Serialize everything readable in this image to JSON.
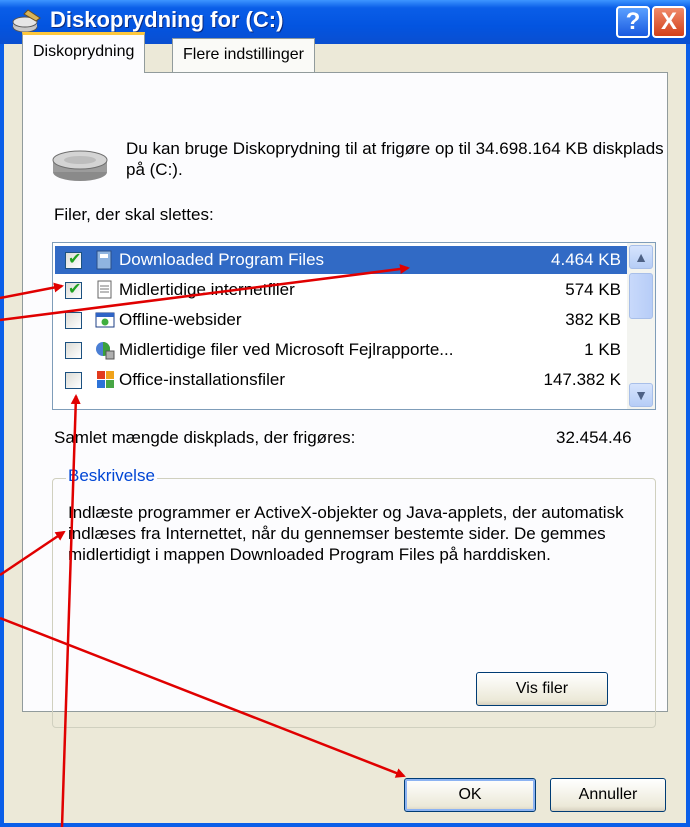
{
  "window": {
    "title": "Diskoprydning for  (C:)",
    "help_button": "?",
    "close_button": "X"
  },
  "tabs": [
    {
      "label": "Diskoprydning",
      "active": true
    },
    {
      "label": "Flere indstillinger",
      "active": false
    }
  ],
  "info": {
    "text": "Du kan bruge Diskoprydning til at frigøre op til 34.698.164 KB diskplads på  (C:).",
    "icon": "hard-drive-icon"
  },
  "files": {
    "label": "Filer, der skal slettes:",
    "items": [
      {
        "name": "Downloaded Program Files",
        "size": "4.464 KB",
        "checked": true,
        "selected": true,
        "icon": "program-files-icon"
      },
      {
        "name": "Midlertidige internetfiler",
        "size": "574 KB",
        "checked": true,
        "selected": false,
        "icon": "document-icon"
      },
      {
        "name": "Offline-websider",
        "size": "382 KB",
        "checked": false,
        "selected": false,
        "icon": "offline-web-icon"
      },
      {
        "name": "Midlertidige filer ved Microsoft Fejlrapporte...",
        "size": "1 KB",
        "checked": false,
        "selected": false,
        "icon": "error-report-icon"
      },
      {
        "name": "Office-installationsfiler",
        "size": "147.382 K",
        "checked": false,
        "selected": false,
        "icon": "office-icon"
      }
    ]
  },
  "total": {
    "label": "Samlet mængde diskplads, der frigøres:",
    "value": "32.454.46"
  },
  "description": {
    "label": "Beskrivelse",
    "text": "Indlæste programmer er ActiveX-objekter og Java-applets, der automatisk indlæses fra Internettet, når du gennemser bestemte sider. De gemmes midlertidigt i mappen Downloaded Program Files på harddisken."
  },
  "buttons": {
    "view_files": "Vis filer",
    "ok": "OK",
    "cancel": "Annuller"
  },
  "colors": {
    "title_bar": "#0a5ee8",
    "selection": "#316ac5",
    "annotation_arrow": "#e00000"
  }
}
